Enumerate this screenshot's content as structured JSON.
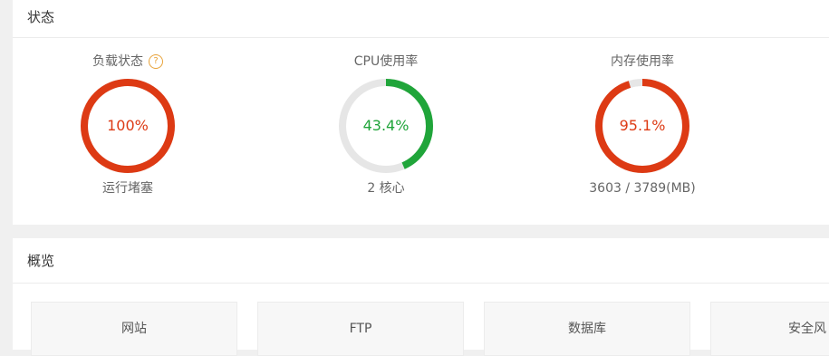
{
  "status": {
    "title": "状态",
    "gauges": [
      {
        "title": "负载状态",
        "value_text": "100%",
        "percent": 100,
        "subtitle": "运行堵塞",
        "color": "#dd3a14",
        "has_help": true,
        "help_glyph": "?"
      },
      {
        "title": "CPU使用率",
        "value_text": "43.4%",
        "percent": 43.4,
        "subtitle": "2 核心",
        "color": "#20a53a",
        "has_help": false
      },
      {
        "title": "内存使用率",
        "value_text": "95.1%",
        "percent": 95.1,
        "subtitle": "3603 / 3789(MB)",
        "color": "#dd3a14",
        "has_help": false
      }
    ],
    "track_color": "#e6e6e6"
  },
  "overview": {
    "title": "概览",
    "tiles": [
      {
        "label": "网站"
      },
      {
        "label": "FTP"
      },
      {
        "label": "数据库"
      },
      {
        "label": "安全风"
      }
    ]
  }
}
